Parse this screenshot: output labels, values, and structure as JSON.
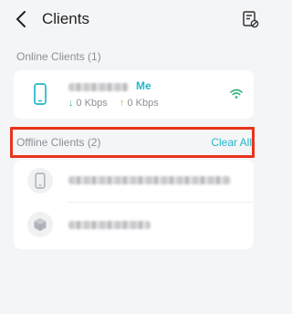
{
  "header": {
    "title": "Clients"
  },
  "online": {
    "label": "Online Clients (1)",
    "client": {
      "me_badge": "Me",
      "download": "0 Kbps",
      "upload": "0 Kbps"
    }
  },
  "offline": {
    "label": "Offline Clients (2)",
    "clear_all": "Clear All"
  },
  "colors": {
    "accent": "#23b8c9",
    "highlight": "#e8341c",
    "download_arrow": "#36b37e",
    "upload_arrow": "#e8a33a"
  },
  "icons": [
    "back-arrow-icon",
    "client-settings-icon",
    "phone-icon",
    "wifi-signal-icon",
    "cube-icon"
  ]
}
